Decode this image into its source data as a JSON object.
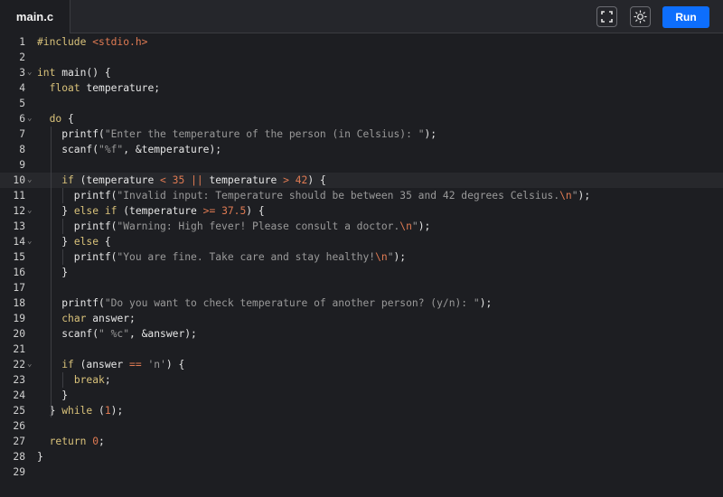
{
  "tab": {
    "label": "main.c"
  },
  "toolbar": {
    "run_label": "Run",
    "fullscreen_icon": "fullscreen-icon",
    "theme_icon": "sun-icon"
  },
  "colors": {
    "run_button": "#0d6efd",
    "keyword": "#d9c27a",
    "string": "#9a9a9a",
    "number": "#e07b53"
  },
  "editor": {
    "active_line": 10,
    "lines": [
      {
        "n": "1",
        "fold": false,
        "t": [
          [
            "pp",
            "#include "
          ],
          [
            "inc",
            "<stdio.h>"
          ]
        ]
      },
      {
        "n": "2",
        "fold": false,
        "t": []
      },
      {
        "n": "3",
        "fold": true,
        "t": [
          [
            "kw",
            "int"
          ],
          [
            "p",
            " main() {"
          ]
        ]
      },
      {
        "n": "4",
        "fold": false,
        "t": [
          [
            "p",
            "  "
          ],
          [
            "kw",
            "float"
          ],
          [
            "p",
            " temperature;"
          ]
        ]
      },
      {
        "n": "5",
        "fold": false,
        "t": []
      },
      {
        "n": "6",
        "fold": true,
        "t": [
          [
            "p",
            "  "
          ],
          [
            "kw",
            "do"
          ],
          [
            "p",
            " {"
          ]
        ]
      },
      {
        "n": "7",
        "fold": false,
        "t": [
          [
            "p",
            "    printf("
          ],
          [
            "str",
            "\"Enter the temperature of the person (in Celsius): \""
          ],
          [
            "p",
            ");"
          ]
        ]
      },
      {
        "n": "8",
        "fold": false,
        "t": [
          [
            "p",
            "    scanf("
          ],
          [
            "str",
            "\"%f\""
          ],
          [
            "p",
            ", &temperature);"
          ]
        ]
      },
      {
        "n": "9",
        "fold": false,
        "t": []
      },
      {
        "n": "10",
        "fold": true,
        "t": [
          [
            "p",
            "    "
          ],
          [
            "kw",
            "if"
          ],
          [
            "p",
            " (temperature "
          ],
          [
            "op",
            "<"
          ],
          [
            "p",
            " "
          ],
          [
            "num",
            "35"
          ],
          [
            "p",
            " "
          ],
          [
            "op",
            "||"
          ],
          [
            "p",
            " temperature "
          ],
          [
            "op",
            ">"
          ],
          [
            "p",
            " "
          ],
          [
            "num",
            "42"
          ],
          [
            "p",
            ") {"
          ]
        ]
      },
      {
        "n": "11",
        "fold": false,
        "t": [
          [
            "p",
            "      printf("
          ],
          [
            "str",
            "\"Invalid input: Temperature should be between 35 and 42 degrees Celsius."
          ],
          [
            "esc",
            "\\n"
          ],
          [
            "str",
            "\""
          ],
          [
            "p",
            ");"
          ]
        ]
      },
      {
        "n": "12",
        "fold": true,
        "t": [
          [
            "p",
            "    } "
          ],
          [
            "kw",
            "else if"
          ],
          [
            "p",
            " (temperature "
          ],
          [
            "op",
            ">="
          ],
          [
            "p",
            " "
          ],
          [
            "num",
            "37.5"
          ],
          [
            "p",
            ") {"
          ]
        ]
      },
      {
        "n": "13",
        "fold": false,
        "t": [
          [
            "p",
            "      printf("
          ],
          [
            "str",
            "\"Warning: High fever! Please consult a doctor."
          ],
          [
            "esc",
            "\\n"
          ],
          [
            "str",
            "\""
          ],
          [
            "p",
            ");"
          ]
        ]
      },
      {
        "n": "14",
        "fold": true,
        "t": [
          [
            "p",
            "    } "
          ],
          [
            "kw",
            "else"
          ],
          [
            "p",
            " {"
          ]
        ]
      },
      {
        "n": "15",
        "fold": false,
        "t": [
          [
            "p",
            "      printf("
          ],
          [
            "str",
            "\"You are fine. Take care and stay healthy!"
          ],
          [
            "esc",
            "\\n"
          ],
          [
            "str",
            "\""
          ],
          [
            "p",
            ");"
          ]
        ]
      },
      {
        "n": "16",
        "fold": false,
        "t": [
          [
            "p",
            "    }"
          ]
        ]
      },
      {
        "n": "17",
        "fold": false,
        "t": []
      },
      {
        "n": "18",
        "fold": false,
        "t": [
          [
            "p",
            "    printf("
          ],
          [
            "str",
            "\"Do you want to check temperature of another person? (y/n): \""
          ],
          [
            "p",
            ");"
          ]
        ]
      },
      {
        "n": "19",
        "fold": false,
        "t": [
          [
            "p",
            "    "
          ],
          [
            "kw",
            "char"
          ],
          [
            "p",
            " answer;"
          ]
        ]
      },
      {
        "n": "20",
        "fold": false,
        "t": [
          [
            "p",
            "    scanf("
          ],
          [
            "str",
            "\" %c\""
          ],
          [
            "p",
            ", &answer);"
          ]
        ]
      },
      {
        "n": "21",
        "fold": false,
        "t": []
      },
      {
        "n": "22",
        "fold": true,
        "t": [
          [
            "p",
            "    "
          ],
          [
            "kw",
            "if"
          ],
          [
            "p",
            " (answer "
          ],
          [
            "op",
            "=="
          ],
          [
            "p",
            " "
          ],
          [
            "str",
            "'n'"
          ],
          [
            "p",
            ") {"
          ]
        ]
      },
      {
        "n": "23",
        "fold": false,
        "t": [
          [
            "p",
            "      "
          ],
          [
            "kw",
            "break"
          ],
          [
            "p",
            ";"
          ]
        ]
      },
      {
        "n": "24",
        "fold": false,
        "t": [
          [
            "p",
            "    }"
          ]
        ]
      },
      {
        "n": "25",
        "fold": false,
        "t": [
          [
            "p",
            "  } "
          ],
          [
            "kw",
            "while"
          ],
          [
            "p",
            " ("
          ],
          [
            "num",
            "1"
          ],
          [
            "p",
            ");"
          ]
        ]
      },
      {
        "n": "26",
        "fold": false,
        "t": []
      },
      {
        "n": "27",
        "fold": false,
        "t": [
          [
            "p",
            "  "
          ],
          [
            "kw",
            "return"
          ],
          [
            "p",
            " "
          ],
          [
            "num",
            "0"
          ],
          [
            "p",
            ";"
          ]
        ]
      },
      {
        "n": "28",
        "fold": false,
        "t": [
          [
            "p",
            "}"
          ]
        ]
      },
      {
        "n": "29",
        "fold": false,
        "t": []
      }
    ]
  }
}
